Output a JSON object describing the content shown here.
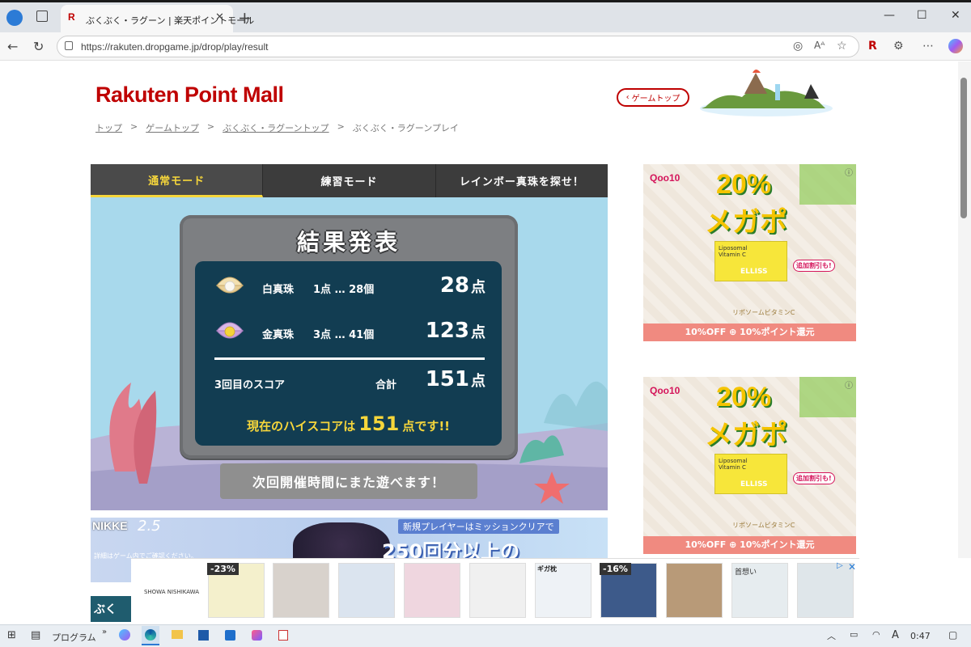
{
  "browser": {
    "tab_title": "ぶくぶく・ラグーン | 楽天ポイントモール",
    "tab_favicon": "R",
    "url": "https://rakuten.dropgame.jp/drop/play/result"
  },
  "header": {
    "logo": "Rakuten Point Mall",
    "game_top_button": "ゲームトップ",
    "breadcrumb": [
      "トップ",
      "ゲームトップ",
      "ぶくぶく・ラグーントップ",
      "ぶくぶく・ラグーンプレイ"
    ]
  },
  "game": {
    "tabs": [
      {
        "label": "通常モード",
        "active": true
      },
      {
        "label": "練習モード",
        "active": false
      },
      {
        "label": "レインボー真珠を探せ！",
        "active": false
      }
    ],
    "result_title": "結果発表",
    "rows": [
      {
        "label": "白真珠",
        "detail": "1点 … 28個",
        "score": "28",
        "unit": "点"
      },
      {
        "label": "金真珠",
        "detail": "3点 … 41個",
        "score": "123",
        "unit": "点"
      }
    ],
    "total": {
      "label": "3回目のスコア",
      "total_label": "合計",
      "score": "151",
      "unit": "点"
    },
    "hiscore": {
      "prefix": "現在のハイスコアは",
      "value": "151",
      "suffix": "点です!!"
    },
    "next_button": "次回開催時間にまた遊べます！"
  },
  "ads": {
    "right": [
      {
        "brand": "Qoo10",
        "headline_pct": "20%",
        "headline": "メガポ",
        "product_name": "Liposomal Vitamin C",
        "product_brand": "ELLISS",
        "badge": "追加割引も!",
        "caption": "リポソームビタミンC",
        "footer": "10%OFF ⊕ 10%ポイント還元"
      },
      {
        "brand": "Qoo10",
        "headline_pct": "20%",
        "headline": "メガポ",
        "product_name": "Liposomal Vitamin C",
        "product_brand": "ELLISS",
        "badge": "追加割引も!",
        "caption": "リポソームビタミンC",
        "footer": "10%OFF ⊕ 10%ポイント還元"
      }
    ],
    "nikke_banner": {
      "brand": "NIKKE",
      "anniv": "2.5",
      "text_top": "新規プレイヤーはミッションクリアで",
      "text_big": "250回分以上の",
      "note": "詳細はゲーム内でご確認ください。"
    },
    "bottom_bar": {
      "discounts": [
        "-23%",
        "-16%"
      ],
      "brand": "SHOWA NISHIKAWA",
      "brand2": "ギガ枕",
      "caption": "首想い",
      "side_text": "ぶく"
    }
  },
  "taskbar": {
    "program_label": "プログラム",
    "time": "0:47",
    "ime": "A"
  }
}
